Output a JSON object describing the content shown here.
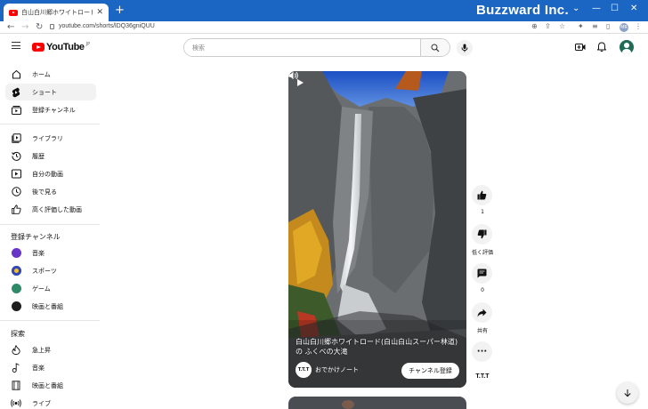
{
  "browser": {
    "tab_title": "白山白川郷ホワイトロード(白 白山スーパー林道)",
    "new_tab": "+",
    "brand": "Buzzward Inc.",
    "url": "youtube.com/shorts/lDQ36gniQUU",
    "profile_initials": "MR"
  },
  "header": {
    "logo_text": "YouTube",
    "logo_cc": "JP",
    "search_placeholder": "検索"
  },
  "sidebar": {
    "main": [
      {
        "label": "ホーム",
        "icon": "home-icon"
      },
      {
        "label": "ショート",
        "icon": "shorts-icon"
      },
      {
        "label": "登録チャンネル",
        "icon": "subscriptions-icon"
      }
    ],
    "library": [
      {
        "label": "ライブラリ",
        "icon": "library-icon"
      },
      {
        "label": "履歴",
        "icon": "history-icon"
      },
      {
        "label": "自分の動画",
        "icon": "your-videos-icon"
      },
      {
        "label": "後で見る",
        "icon": "watch-later-icon"
      },
      {
        "label": "高く評価した動画",
        "icon": "liked-icon"
      }
    ],
    "subscriptions_heading": "登録チャンネル",
    "subscriptions": [
      {
        "label": "音楽",
        "color": "#6a35c9"
      },
      {
        "label": "スポーツ",
        "color": "#3348b8"
      },
      {
        "label": "ゲーム",
        "color": "#2f8a6a"
      },
      {
        "label": "映画と番組",
        "color": "#1f1f1f"
      }
    ],
    "explore_heading": "探索",
    "explore": [
      {
        "label": "急上昇",
        "icon": "trending-icon"
      },
      {
        "label": "音楽",
        "icon": "music-icon"
      },
      {
        "label": "映画と番組",
        "icon": "movies-icon"
      },
      {
        "label": "ライブ",
        "icon": "live-icon"
      }
    ]
  },
  "short": {
    "title": "白山白川郷ホワイトロード(白山白山スーパー林道)の ふくべの大滝",
    "channel_avatar": "T.T.T",
    "channel_name": "おでかけノート",
    "subscribe_label": "チャンネル登録"
  },
  "actions": {
    "like_count": "1",
    "dislike_label": "低く評価",
    "comment_count": "0",
    "share_label": "共有",
    "channel_label": "T.T.T"
  }
}
